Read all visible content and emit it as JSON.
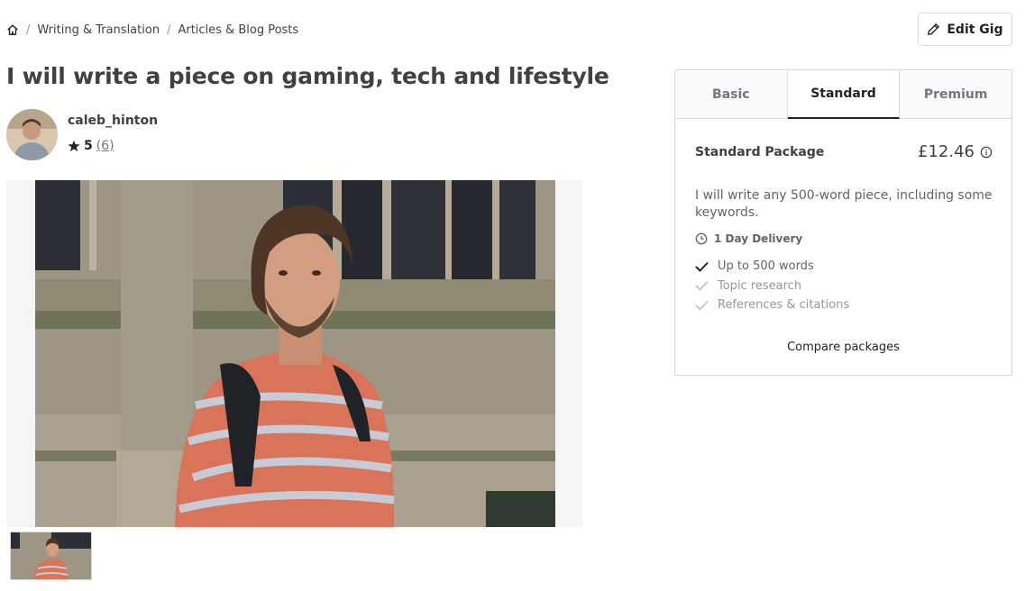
{
  "breadcrumb": {
    "home_icon": "home-icon",
    "items": [
      "Writing & Translation",
      "Articles & Blog Posts"
    ]
  },
  "edit_gig": {
    "label": "Edit Gig",
    "icon": "pencil-icon"
  },
  "gig": {
    "title": "I will write a piece on gaming, tech and lifestyle"
  },
  "seller": {
    "name": "caleb_hinton",
    "rating": "5",
    "review_count": "(6)"
  },
  "packages": {
    "tabs": [
      "Basic",
      "Standard",
      "Premium"
    ],
    "active_tab": "Standard",
    "name": "Standard Package",
    "price": "£12.46",
    "description": "I will write any 500-word piece, including some keywords.",
    "delivery": "1 Day Delivery",
    "features": [
      {
        "label": "Up to 500 words",
        "included": true
      },
      {
        "label": "Topic research",
        "included": false
      },
      {
        "label": "References & citations",
        "included": false
      }
    ],
    "compare_label": "Compare packages"
  },
  "colors": {
    "text": "#404145",
    "muted": "#74767e",
    "border": "#dadbdd",
    "check_on": "#222325",
    "check_off": "#c5c6c9"
  }
}
